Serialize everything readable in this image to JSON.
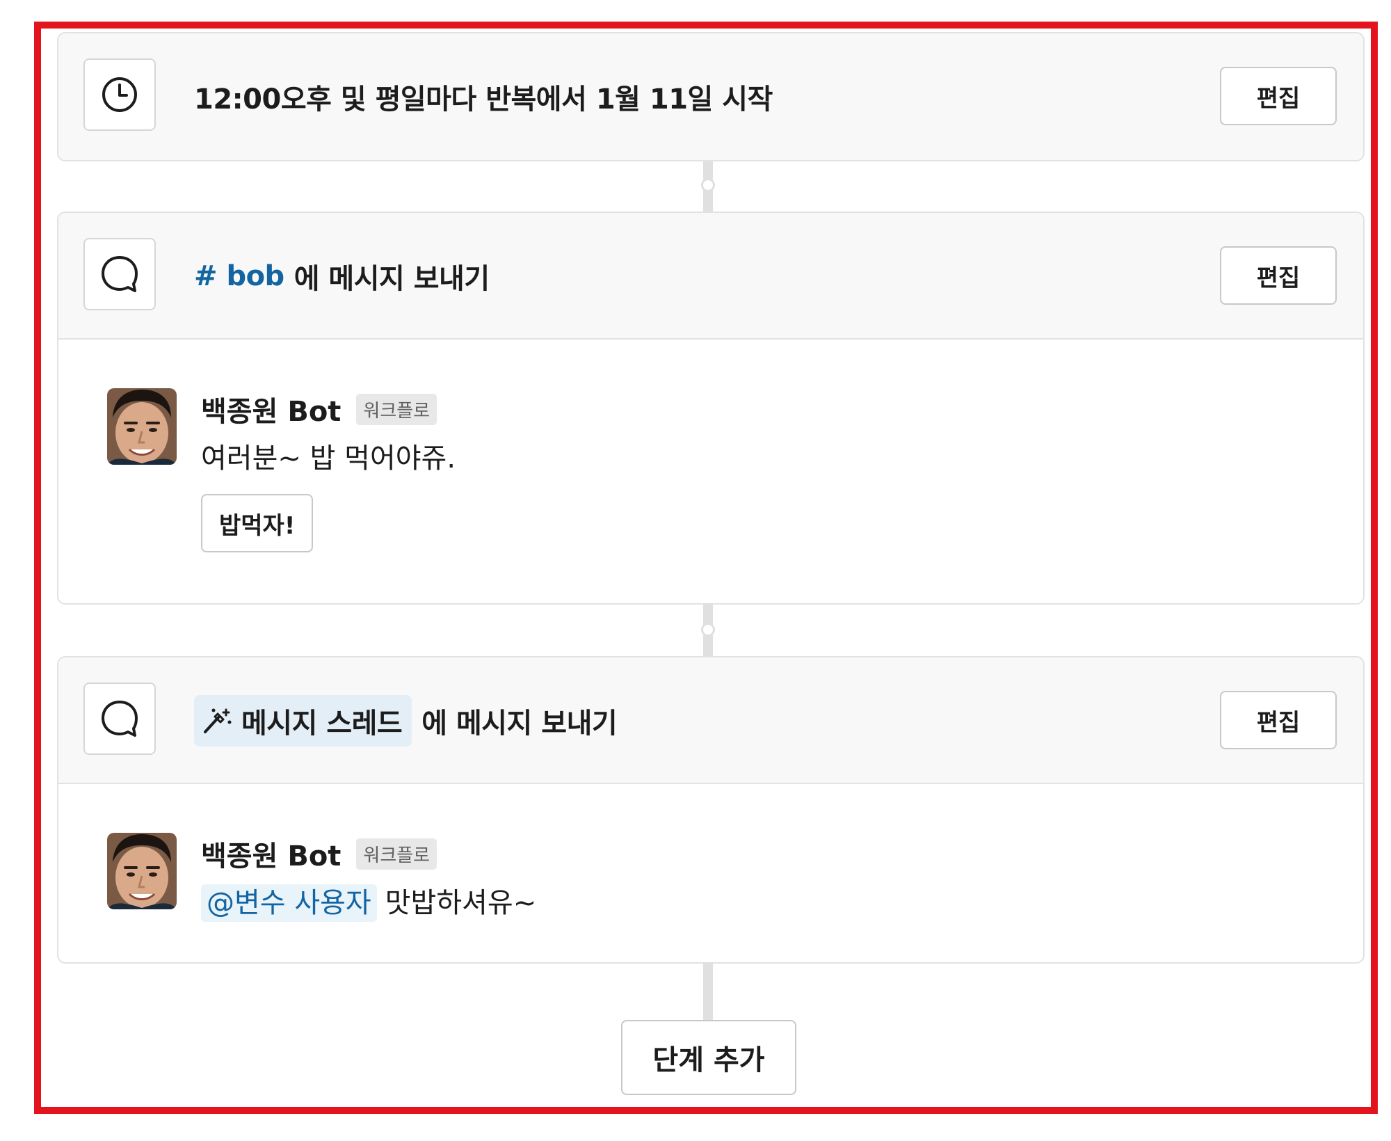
{
  "steps": [
    {
      "icon": "clock-icon",
      "title": "12:00오후 및 평일마다 반복에서 1월 11일 시작",
      "edit_label": "편집"
    },
    {
      "icon": "message-bubble-icon",
      "channel": "# bob",
      "title_suffix": "에 메시지 보내기",
      "edit_label": "편집",
      "message": {
        "sender": "백종원 Bot",
        "badge": "워크플로",
        "text": "여러분~ 밥 먹어야쥬.",
        "button_label": "밥먹자!"
      }
    },
    {
      "icon": "message-bubble-icon",
      "variable_chip": "메시지 스레드",
      "variable_icon": "magic-wand-icon",
      "title_suffix": "에 메시지 보내기",
      "edit_label": "편집",
      "message": {
        "sender": "백종원 Bot",
        "badge": "워크플로",
        "mention": "@변수 사용자",
        "text": "맛밥하셔유~"
      }
    }
  ],
  "add_step_label": "단계 추가",
  "colors": {
    "highlight_border": "#e3141e",
    "link": "#1264a3",
    "chip_bg": "#e3eef6",
    "header_bg": "#f8f8f8"
  }
}
